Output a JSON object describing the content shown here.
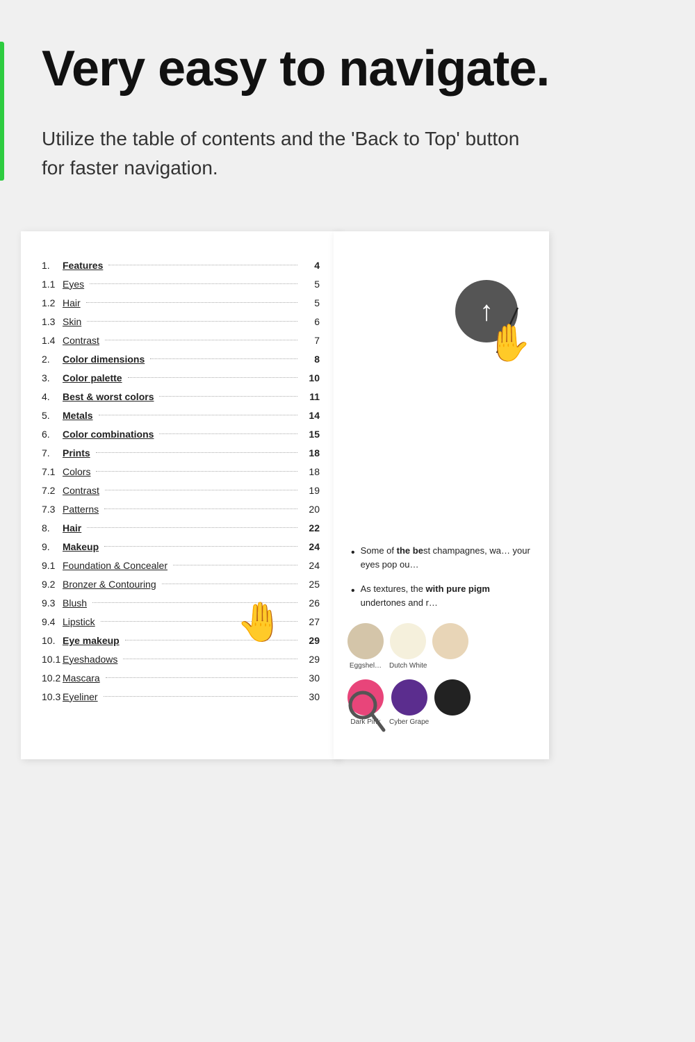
{
  "header": {
    "main_title": "Very easy to navigate.",
    "subtitle": "Utilize the table of contents and the 'Back to Top' button for faster navigation."
  },
  "toc": {
    "items": [
      {
        "num": "1.",
        "title": "Features",
        "page": "4",
        "bold": true
      },
      {
        "num": "1.1",
        "title": "Eyes",
        "page": "5",
        "bold": false
      },
      {
        "num": "1.2",
        "title": "Hair",
        "page": "5",
        "bold": false
      },
      {
        "num": "1.3",
        "title": "Skin",
        "page": "6",
        "bold": false
      },
      {
        "num": "1.4",
        "title": "Contrast",
        "page": "7",
        "bold": false
      },
      {
        "num": "2.",
        "title": "Color dimensions",
        "page": "8",
        "bold": true
      },
      {
        "num": "3.",
        "title": "Color palette",
        "page": "10",
        "bold": true
      },
      {
        "num": "4.",
        "title": "Best & worst colors",
        "page": "11",
        "bold": true
      },
      {
        "num": "5.",
        "title": "Metals",
        "page": "14",
        "bold": true
      },
      {
        "num": "6.",
        "title": "Color combinations",
        "page": "15",
        "bold": true
      },
      {
        "num": "7.",
        "title": "Prints",
        "page": "18",
        "bold": true
      },
      {
        "num": "7.1",
        "title": "Colors",
        "page": "18",
        "bold": false
      },
      {
        "num": "7.2",
        "title": "Contrast",
        "page": "19",
        "bold": false
      },
      {
        "num": "7.3",
        "title": "Patterns",
        "page": "20",
        "bold": false
      },
      {
        "num": "8.",
        "title": "Hair",
        "page": "22",
        "bold": true
      },
      {
        "num": "9.",
        "title": "Makeup",
        "page": "24",
        "bold": true
      },
      {
        "num": "9.1",
        "title": "Foundation & Concealer",
        "page": "24",
        "bold": false
      },
      {
        "num": "9.2",
        "title": "Bronzer & Contouring",
        "page": "25",
        "bold": false
      },
      {
        "num": "9.3",
        "title": "Blush",
        "page": "26",
        "bold": false
      },
      {
        "num": "9.4",
        "title": "Lipstick",
        "page": "27",
        "bold": false
      },
      {
        "num": "10.",
        "title": "Eye makeup",
        "page": "29",
        "bold": true
      },
      {
        "num": "10.1",
        "title": "Eyeshadows",
        "page": "29",
        "bold": false
      },
      {
        "num": "10.2",
        "title": "Mascara",
        "page": "30",
        "bold": false
      },
      {
        "num": "10.3",
        "title": "Eyeliner",
        "page": "30",
        "bold": false
      }
    ]
  },
  "content_panel": {
    "bullet1_start": "Some of ",
    "bullet1_bold": "the be",
    "bullet1_end": "st champagnes, wa… your eyes pop ou…",
    "bullet2_start": "As textures, the ",
    "bullet2_bold": "with pure pigm",
    "bullet2_end": "undertones and r…"
  },
  "swatches": [
    {
      "label": "Eggshel…",
      "color": "#d4c5a9"
    },
    {
      "label": "Dutch White",
      "color": "#f5f0dc"
    },
    {
      "label": "",
      "color": "#e8d5b7"
    },
    {
      "label": "Dark Pink",
      "color": "#e8457a"
    },
    {
      "label": "Cyber Grape",
      "color": "#5b2d8e"
    },
    {
      "label": "",
      "color": "#222222"
    }
  ],
  "icons": {
    "arrow_up": "↑",
    "bullet_dot": "•",
    "magnifier": "🔍"
  }
}
